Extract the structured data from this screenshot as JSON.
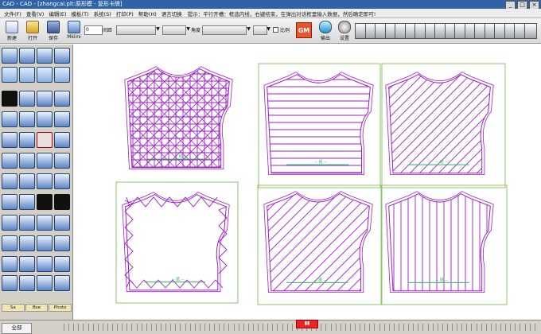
{
  "window": {
    "title": "CAD - CAD - [zhangcai.plt:原形模 - 复形卡牌]"
  },
  "menubar": {
    "items": [
      "文件(F)",
      "查看(V)",
      "编辑(E)",
      "模板(T)",
      "系统(S)",
      "打印(P)",
      "帮助(H)",
      "语言切换"
    ],
    "hint": "提示：平行开槽：框选内线，右键结束，在弹出对话框里输入数据，然后确定即可!"
  },
  "toolbar": {
    "new_label": "新建",
    "open_label": "打开",
    "save_label": "保存",
    "mode_label": "Mkiini",
    "spacing_label": "间距",
    "spacing_value": "0",
    "angle_label": "角度",
    "ratio_label": "比例",
    "brand_label": "GM",
    "output_label": "输出",
    "settings_label": "设置"
  },
  "palette": {
    "tabs": [
      "Sa",
      "Bse",
      "Photo"
    ]
  },
  "canvas": {
    "piece_note": "--  纸  --"
  },
  "statusbar": {
    "all_label": "全部"
  },
  "colors": {
    "titlebar": "#2f63a8",
    "pattern_line": "#9b1ec8",
    "frame_green": "#8dc36a",
    "grainline": "#29b85b",
    "accent_red": "#e22222"
  }
}
